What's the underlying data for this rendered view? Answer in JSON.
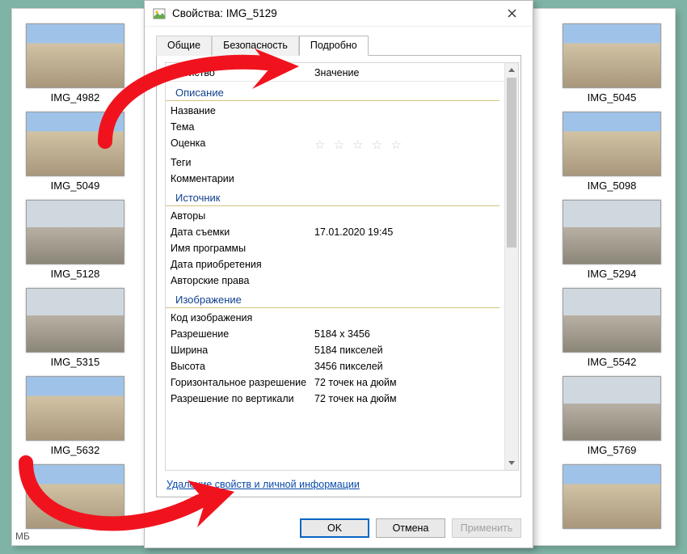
{
  "background": {
    "hint_bottom_left": "МБ",
    "left_column": [
      {
        "label": "IMG_4982",
        "style": "roman"
      },
      {
        "label": "IMG_5049",
        "style": "roman"
      },
      {
        "label": "IMG_5128",
        "style": "city"
      },
      {
        "label": "IMG_5315",
        "style": "city"
      },
      {
        "label": "IMG_5632",
        "style": "roman"
      },
      {
        "label": "",
        "style": "roman"
      }
    ],
    "right_column": [
      {
        "label": "IMG_5045",
        "style": "roman"
      },
      {
        "label": "IMG_5098",
        "style": "roman"
      },
      {
        "label": "IMG_5294",
        "style": "city"
      },
      {
        "label": "IMG_5542",
        "style": "city"
      },
      {
        "label": "IMG_5769",
        "style": "city"
      },
      {
        "label": "",
        "style": "roman"
      }
    ]
  },
  "dialog": {
    "title": "Свойства: IMG_5129",
    "tabs": {
      "general": "Общие",
      "security": "Безопасность",
      "details": "Подробно"
    },
    "header": {
      "property": "Свойство",
      "value": "Значение"
    },
    "sections": {
      "desc": "Описание",
      "origin": "Источник",
      "image": "Изображение"
    },
    "rows": {
      "title": "Название",
      "subject": "Тема",
      "rating": "Оценка",
      "tags": "Теги",
      "comments": "Комментарии",
      "authors": "Авторы",
      "date_taken": "Дата съемки",
      "date_taken_val": "17.01.2020 19:45",
      "program": "Имя программы",
      "date_acq": "Дата приобретения",
      "copyright": "Авторские права",
      "img_id": "Код изображения",
      "dimensions": "Разрешение",
      "dimensions_val": "5184 x 3456",
      "width": "Ширина",
      "width_val": "5184 пикселей",
      "height": "Высота",
      "height_val": "3456 пикселей",
      "hres": "Горизонтальное разрешение",
      "hres_val": "72 точек на дюйм",
      "vres": "Разрешение по вертикали",
      "vres_val": "72 точек на дюйм"
    },
    "link": "Удаление свойств и личной информации",
    "buttons": {
      "ok": "OK",
      "cancel": "Отмена",
      "apply": "Применить"
    }
  },
  "colors": {
    "accent": "#0a66c2",
    "section": "#10418f",
    "anno": "#f0131e"
  }
}
